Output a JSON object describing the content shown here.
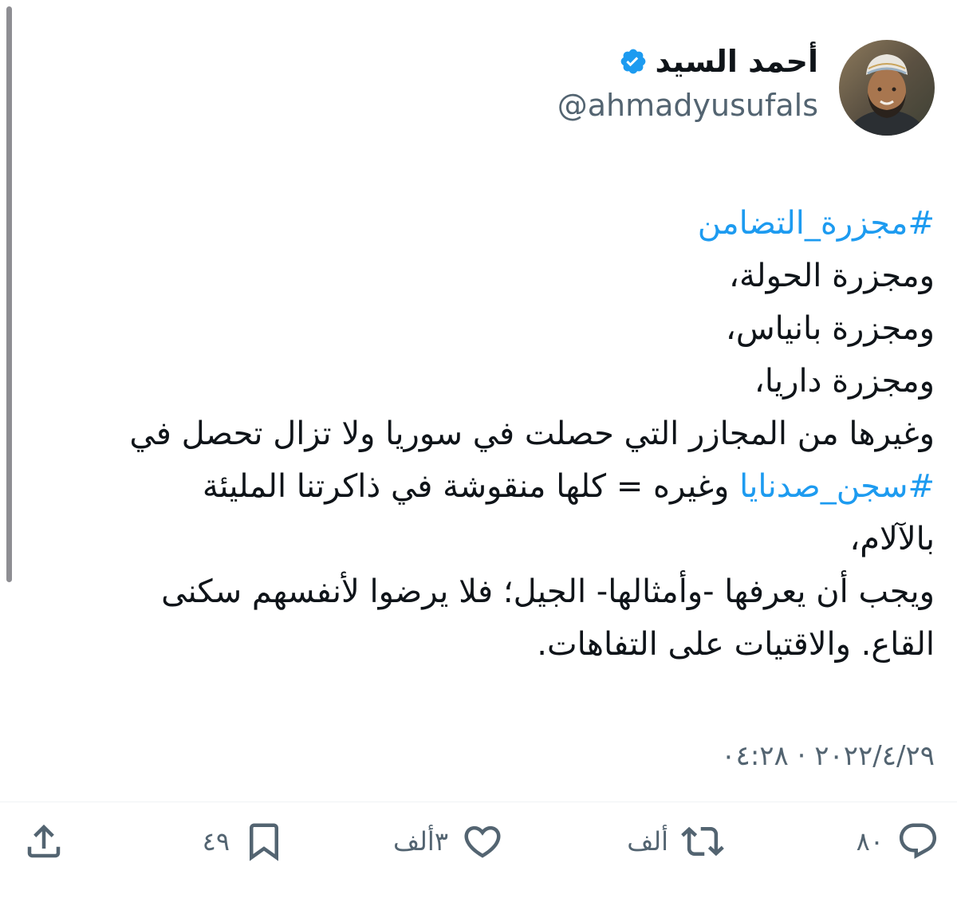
{
  "author": {
    "display_name": "أحمد السيد",
    "handle": "@ahmadyusufals",
    "verified": true,
    "verified_color": "#1d9bf0"
  },
  "tweet": {
    "lines": [
      {
        "type": "hashtag",
        "text": "#مجزرة_التضامن"
      },
      {
        "type": "text",
        "text": "ومجزرة الحولة،"
      },
      {
        "type": "text",
        "text": "ومجزرة بانياس،"
      },
      {
        "type": "text",
        "text": "ومجزرة داريا،"
      },
      {
        "type": "text",
        "text": "وغيرها من المجازر التي حصلت في سوريا ولا تزال تحصل في"
      },
      {
        "type": "mixed",
        "hashtag": "#سجن_صدنايا",
        "text": " وغيره = كلها منقوشة في ذاكرتنا المليئة"
      },
      {
        "type": "text",
        "text": "بالآلام،"
      },
      {
        "type": "text",
        "text": "ويجب أن يعرفها -وأمثالها- الجيل؛ فلا يرضوا لأنفسهم سكنى"
      },
      {
        "type": "text",
        "text": "القاع. والاقتيات على التفاهات."
      }
    ],
    "hashtag_color": "#1d9bf0",
    "timestamp": "٢٠٢٢/٤/٢٩ · ٠٤:٢٨"
  },
  "actions": {
    "reply": {
      "icon": "reply-icon",
      "count": "٨٠"
    },
    "retweet": {
      "icon": "retweet-icon",
      "count": "ألف"
    },
    "like": {
      "icon": "heart-icon",
      "count": "٣ألف"
    },
    "bookmark": {
      "icon": "bookmark-icon",
      "count": "٤٩"
    },
    "share": {
      "icon": "share-icon"
    }
  }
}
